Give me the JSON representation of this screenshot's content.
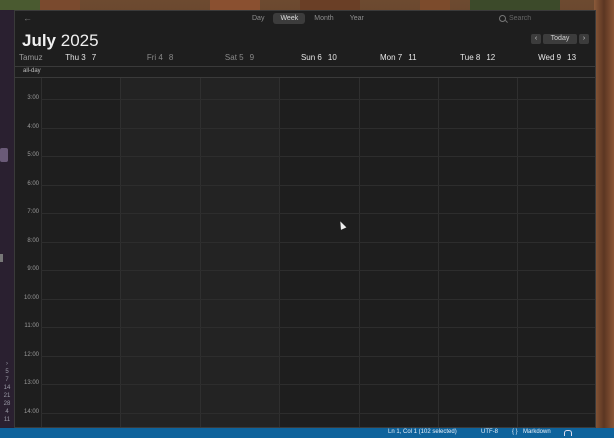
{
  "toolbar": {
    "views": [
      {
        "label": "Day",
        "active": false
      },
      {
        "label": "Week",
        "active": true
      },
      {
        "label": "Month",
        "active": false
      },
      {
        "label": "Year",
        "active": false
      }
    ],
    "search_placeholder": "Search"
  },
  "header": {
    "month": "July",
    "year": "2025",
    "today_label": "Today",
    "prev_icon": "chevron-left-icon",
    "next_icon": "chevron-right-icon"
  },
  "subcalendar_label": "Tamuz",
  "days": [
    {
      "name": "Thu 3",
      "alt": "7",
      "dim": false
    },
    {
      "name": "Fri 4",
      "alt": "8",
      "dim": true
    },
    {
      "name": "Sat 5",
      "alt": "9",
      "dim": true
    },
    {
      "name": "Sun 6",
      "alt": "10",
      "dim": false
    },
    {
      "name": "Mon 7",
      "alt": "11",
      "dim": false
    },
    {
      "name": "Tue 8",
      "alt": "12",
      "dim": false
    },
    {
      "name": "Wed 9",
      "alt": "13",
      "dim": false
    }
  ],
  "allday_label": "all-day",
  "hours": [
    "3:00",
    "4:00",
    "5:00",
    "6:00",
    "7:00",
    "8:00",
    "9:00",
    "10:00",
    "11:00",
    "12:00",
    "13:00",
    "14:00"
  ],
  "sidebar_numbers": [
    "5",
    "7",
    "14",
    "21",
    "28",
    "4",
    "11"
  ],
  "statusbar": {
    "position": "Ln 1, Col 1 (102 selected)",
    "encoding": "UTF-8",
    "language": "Markdown",
    "language_icon": "braces-icon",
    "notifications_icon": "bell-icon"
  },
  "colors": {
    "window_bg": "#1e1e1e",
    "statusbar_bg": "#0e639c",
    "weekend_shade": "#232323"
  }
}
